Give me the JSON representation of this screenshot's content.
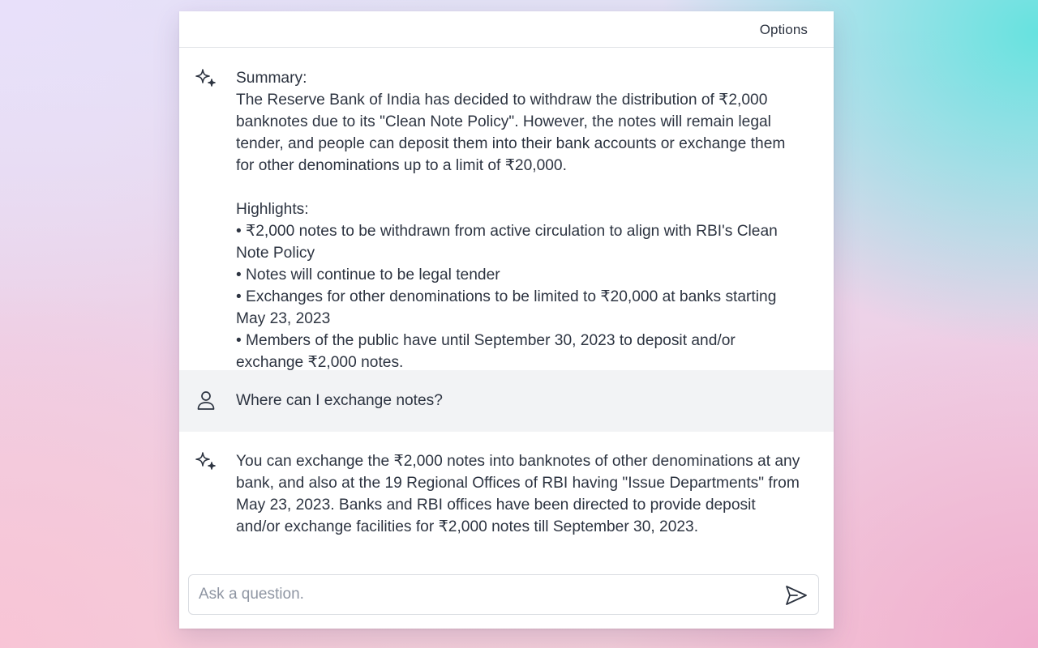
{
  "header": {
    "options_label": "Options"
  },
  "messages": [
    {
      "role": "assistant",
      "avatar_icon": "sparkle-icon",
      "lines": [
        "Summary:",
        "The Reserve Bank of India has decided to withdraw the distribution of ₹2,000",
        "banknotes due to its \"Clean Note Policy\". However, the notes will remain legal",
        "tender, and people can deposit them into their bank accounts or exchange them",
        "for other denominations up to a limit of ₹20,000.",
        "",
        "Highlights:",
        "• ₹2,000 notes to be withdrawn from active circulation to align with RBI's Clean",
        "Note Policy",
        "• Notes will continue to be legal tender",
        "• Exchanges for other denominations to be limited to ₹20,000 at banks starting",
        "May 23, 2023",
        "• Members of the public have until September 30, 2023 to deposit and/or",
        "exchange ₹2,000 notes."
      ]
    },
    {
      "role": "user",
      "avatar_icon": "user-icon",
      "lines": [
        "Where can I exchange notes?"
      ]
    },
    {
      "role": "assistant",
      "avatar_icon": "sparkle-icon",
      "lines": [
        "You can exchange the ₹2,000 notes into banknotes of other denominations at any",
        "bank, and also at the 19 Regional Offices of RBI having \"Issue Departments\" from",
        "May 23, 2023. Banks and RBI offices have been directed to provide deposit",
        "and/or exchange facilities for ₹2,000 notes till September 30, 2023."
      ]
    }
  ],
  "composer": {
    "placeholder": "Ask a question.",
    "value": "",
    "send_icon": "send-icon"
  },
  "colors": {
    "text": "#2d3441",
    "user_row_bg": "#f2f3f5",
    "placeholder": "#8f96a3",
    "border": "#d9dce1"
  }
}
